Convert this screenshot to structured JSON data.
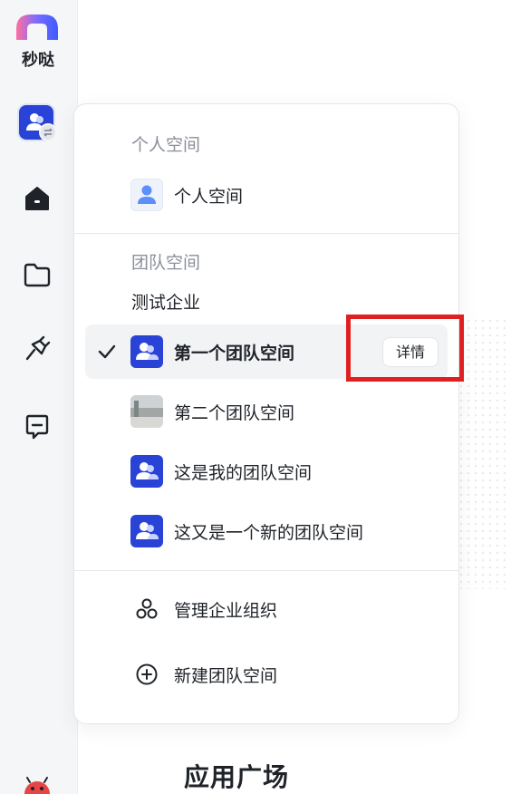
{
  "app": {
    "name": "秒哒"
  },
  "dropdown": {
    "personal_section_title": "个人空间",
    "personal_item": "个人空间",
    "team_section_title": "团队空间",
    "org_name": "测试企业",
    "teams": [
      {
        "label": "第一个团队空间",
        "selected": true,
        "avatar": "team-avatar-icon"
      },
      {
        "label": "第二个团队空间",
        "selected": false,
        "avatar": "photo-avatar"
      },
      {
        "label": "这是我的团队空间",
        "selected": false,
        "avatar": "team-avatar-icon"
      },
      {
        "label": "这又是一个新的团队空间",
        "selected": false,
        "avatar": "team-avatar-icon"
      }
    ],
    "detail_button": "详情",
    "manage_org": "管理企业组织",
    "new_team": "新建团队空间"
  },
  "page": {
    "title": "应用广场"
  },
  "colors": {
    "accent": "#2843d6",
    "highlight": "#e02020",
    "muted": "#8a8f99"
  },
  "icons": [
    "logo-icon",
    "space-switch-icon",
    "home-icon",
    "folder-icon",
    "plugin-icon",
    "chat-icon",
    "check-icon",
    "org-icon",
    "add-circle-icon",
    "mascot-icon"
  ]
}
